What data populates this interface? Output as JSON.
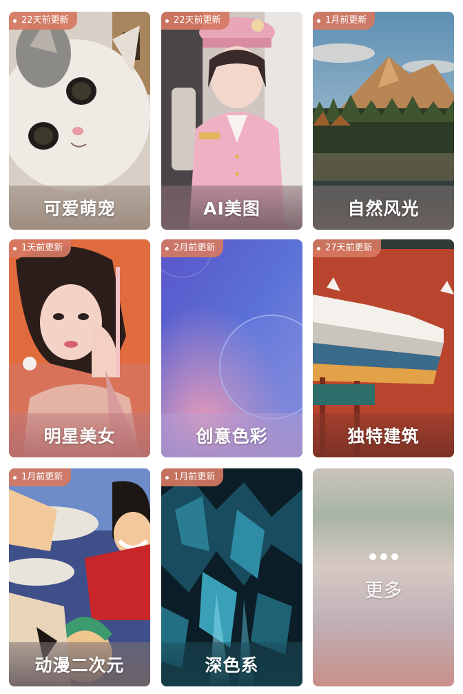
{
  "categories": [
    {
      "name": "可爱萌宠",
      "updated": "22天前更新",
      "bar_color": "#9b8a7e"
    },
    {
      "name": "AI美图",
      "updated": "22天前更新",
      "bar_color": "#8a6d74"
    },
    {
      "name": "自然风光",
      "updated": "1月前更新",
      "bar_color": "#7f7571"
    },
    {
      "name": "明星美女",
      "updated": "1天前更新",
      "bar_color": "#c0797a"
    },
    {
      "name": "创意色彩",
      "updated": "2月前更新",
      "bar_color": "#a58fc9"
    },
    {
      "name": "独特建筑",
      "updated": "27天前更新",
      "bar_color": "#8e3b2c"
    },
    {
      "name": "动漫二次元",
      "updated": "1月前更新",
      "bar_color": "#7e7174"
    },
    {
      "name": "深色系",
      "updated": "1月前更新",
      "bar_color": "#1c4f5e"
    }
  ],
  "more": {
    "label": "更多",
    "icon": "more-dots-icon"
  },
  "colors": {
    "badge": "#d67862",
    "text": "#ffffff"
  }
}
